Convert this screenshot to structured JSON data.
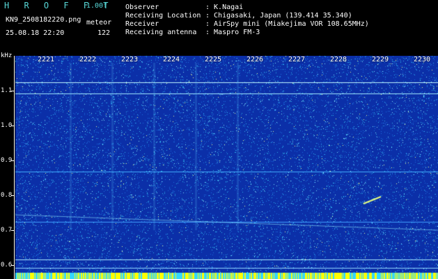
{
  "header": {
    "title": "H R O F F T",
    "version": "1.00f",
    "filename": "KN9_2508182220.png",
    "mode": "meteor",
    "datetime": "25.08.18 22:20",
    "count": "122",
    "info": [
      {
        "label": "Observer",
        "value": ": K.Nagai"
      },
      {
        "label": "Receiving Location",
        "value": ": Chigasaki, Japan (139.414 35.340)"
      },
      {
        "label": "Receiver",
        "value": ": AirSpy mini (Miakejima VOR 108.65MHz)"
      },
      {
        "label": "Receiving antenna",
        "value": ": Maspro FM-3"
      }
    ]
  },
  "spectrogram": {
    "y_unit": "kHz",
    "y_ticks": [
      "1.1",
      "1.0",
      "0.9",
      "0.8",
      "0.7",
      "0.6"
    ],
    "time_labels": [
      "2221",
      "2222",
      "2223",
      "2224",
      "2225",
      "2226",
      "2227",
      "2228",
      "2229",
      "2230"
    ],
    "colors": {
      "background": "#0b2fa8",
      "noise": "#4fd0ff",
      "line": "#c8f0ff",
      "bottom_bar": "#ffff00"
    }
  }
}
